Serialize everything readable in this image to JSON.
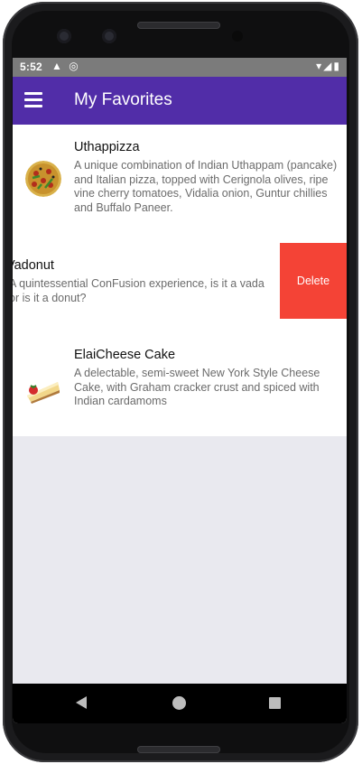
{
  "status_bar": {
    "time": "5:52",
    "left_icons": [
      "warning-icon",
      "sync-icon"
    ],
    "right_icons": [
      "wifi-icon",
      "signal-icon",
      "battery-icon"
    ]
  },
  "app_bar": {
    "menu_icon": "hamburger-menu-icon",
    "title": "My Favorites",
    "color": "#512da8"
  },
  "favorites": [
    {
      "title": "Uthappizza",
      "description": "A unique combination of Indian Uthappam (pancake) and Italian pizza, topped with Cerignola olives, ripe vine cherry tomatoes, Vidalia onion, Guntur chillies and Buffalo Paneer."
    },
    {
      "title": "Vadonut",
      "description": "A quintessential ConFusion experience, is it a vada or is it a donut?",
      "delete_label": "Delete",
      "delete_color": "#f44336"
    },
    {
      "title": "ElaiCheese Cake",
      "description": "A delectable, semi-sweet New York Style Cheese Cake, with Graham cracker crust and spiced with Indian cardamoms"
    }
  ],
  "nav_bar": {
    "back_icon": "back-triangle-icon",
    "home_icon": "home-circle-icon",
    "recent_icon": "recent-apps-square-icon"
  }
}
